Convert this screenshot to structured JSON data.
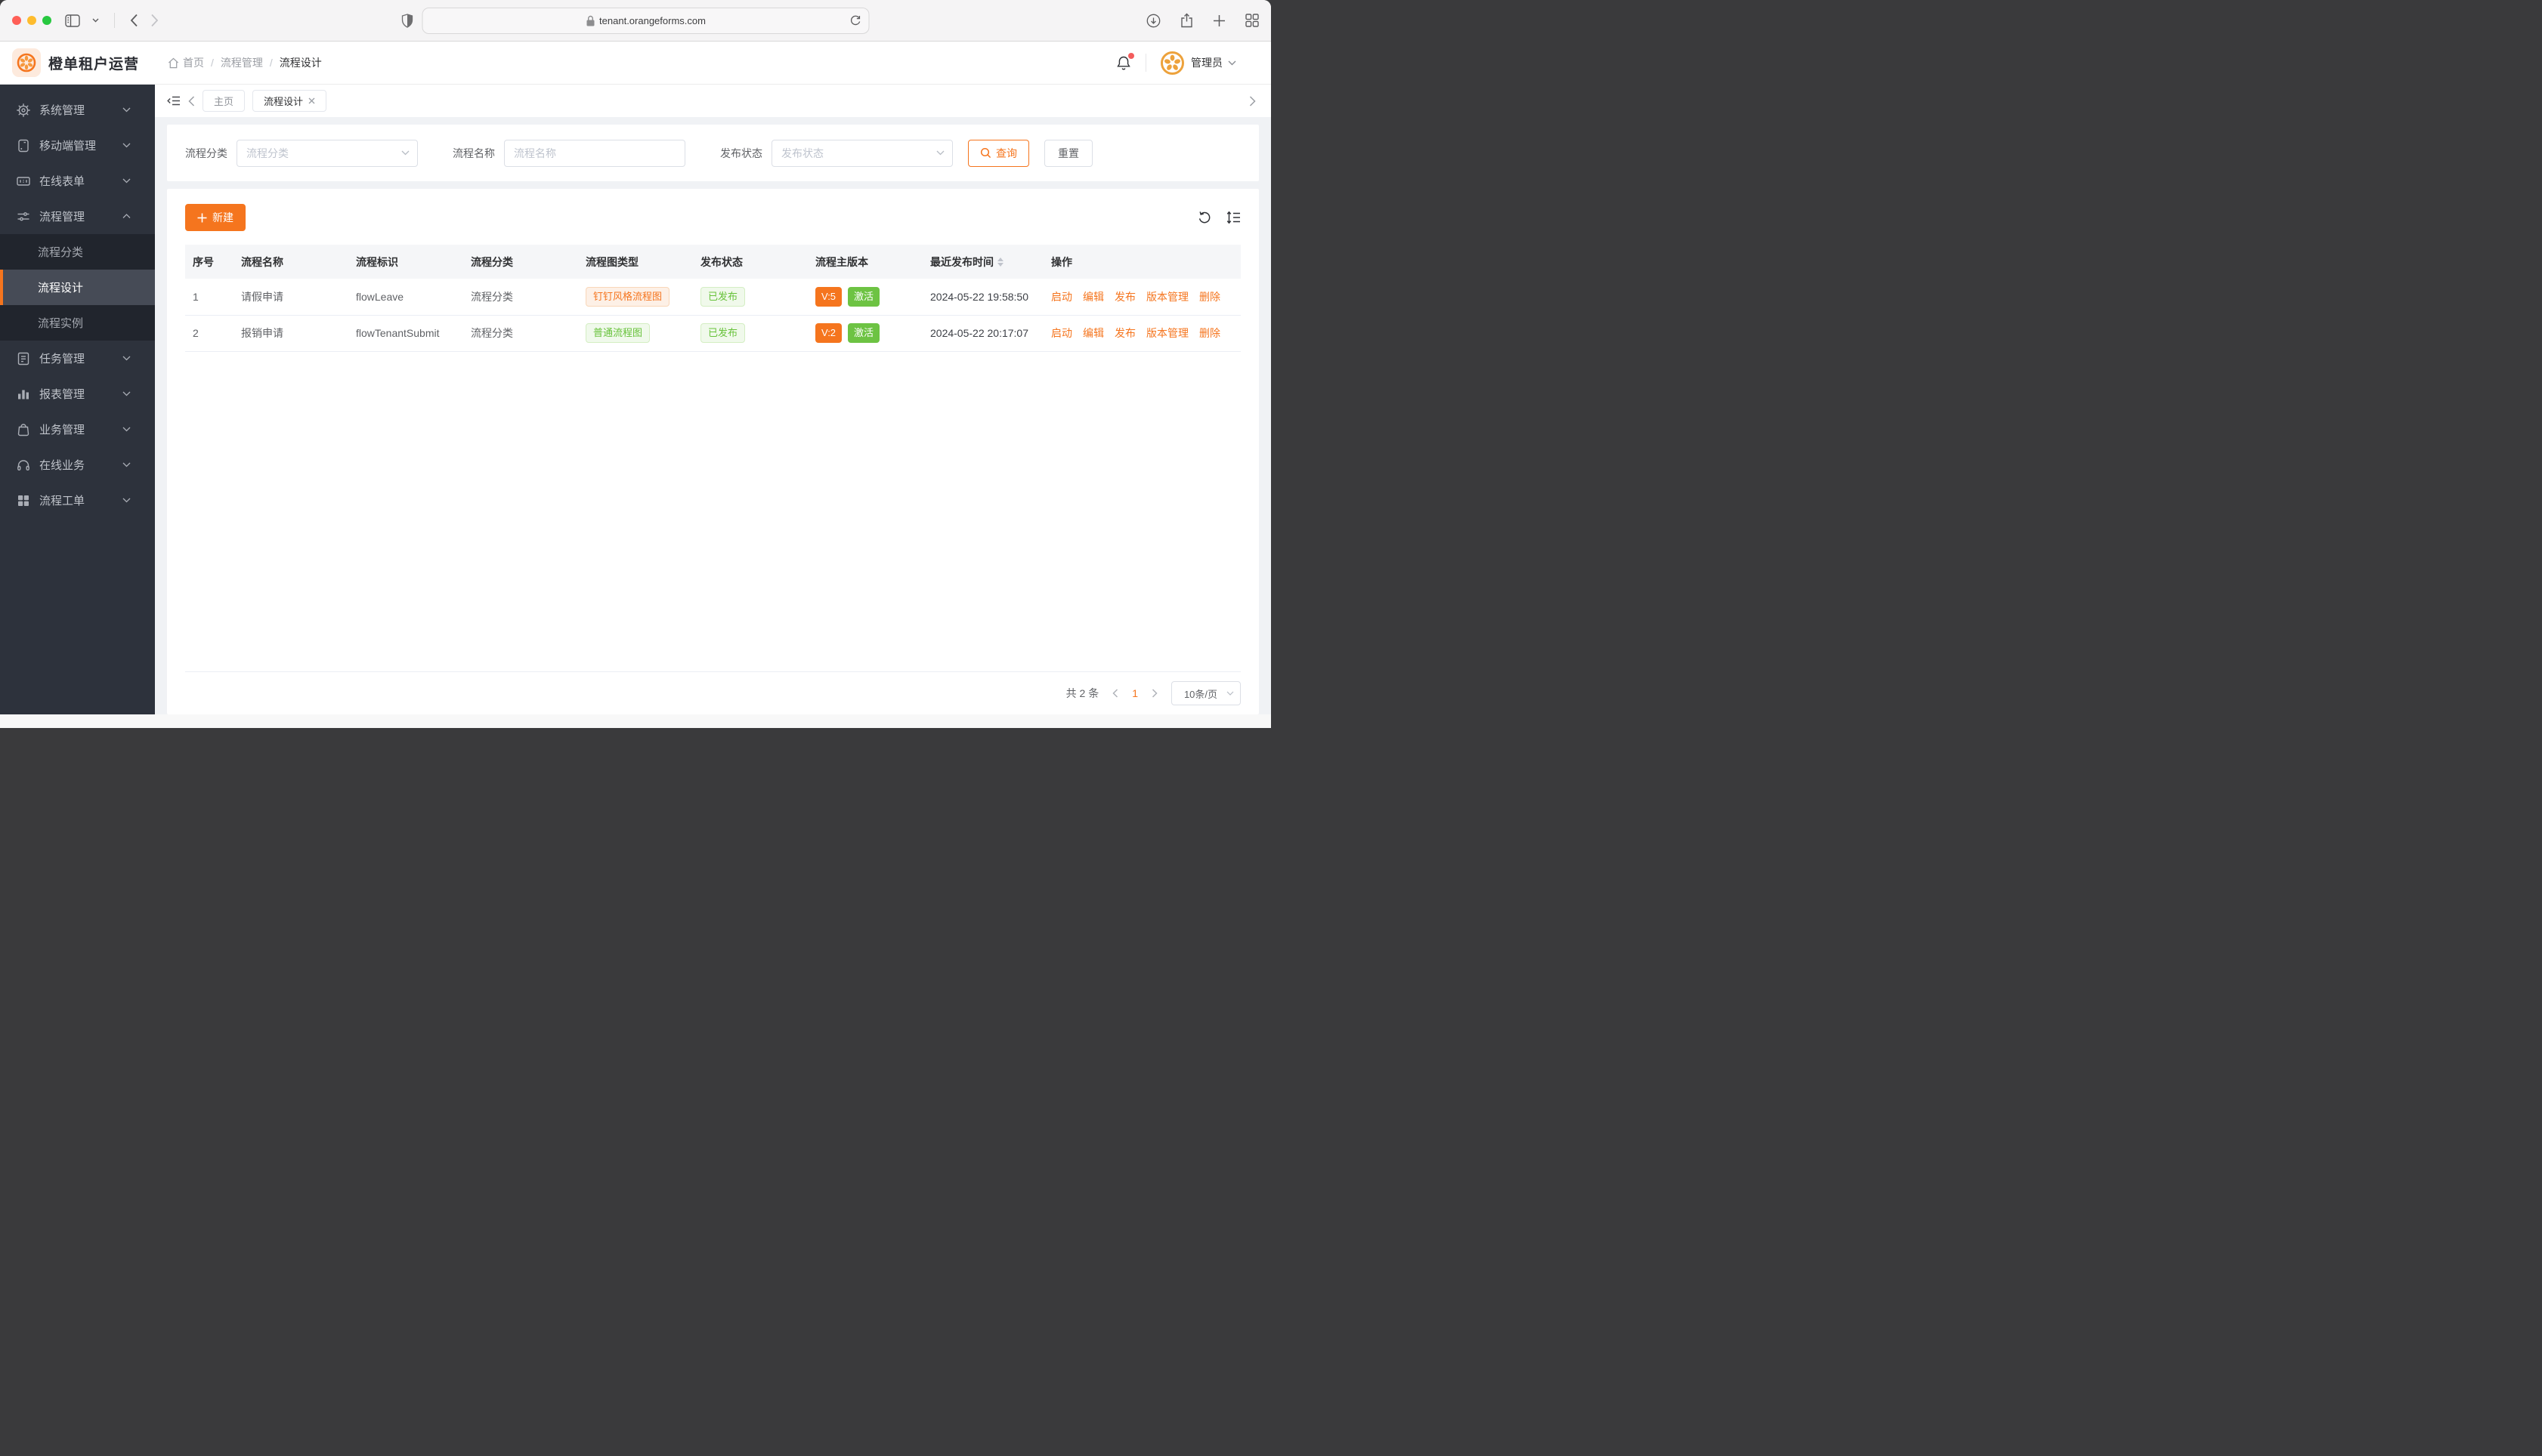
{
  "browser": {
    "url": "tenant.orangeforms.com"
  },
  "header": {
    "app_title": "橙单租户运营",
    "breadcrumb": {
      "home": "首页",
      "section": "流程管理",
      "current": "流程设计"
    },
    "user_name": "管理员"
  },
  "sidebar": {
    "items": [
      {
        "label": "系统管理"
      },
      {
        "label": "移动端管理"
      },
      {
        "label": "在线表单"
      },
      {
        "label": "流程管理",
        "children": [
          {
            "label": "流程分类"
          },
          {
            "label": "流程设计"
          },
          {
            "label": "流程实例"
          }
        ]
      },
      {
        "label": "任务管理"
      },
      {
        "label": "报表管理"
      },
      {
        "label": "业务管理"
      },
      {
        "label": "在线业务"
      },
      {
        "label": "流程工单"
      }
    ]
  },
  "tabs": {
    "home": "主页",
    "active": "流程设计"
  },
  "filters": {
    "category_label": "流程分类",
    "category_placeholder": "流程分类",
    "name_label": "流程名称",
    "name_placeholder": "流程名称",
    "status_label": "发布状态",
    "status_placeholder": "发布状态",
    "search_button": "查询",
    "reset_button": "重置"
  },
  "toolbar": {
    "create_button": "新建"
  },
  "table": {
    "columns": [
      "序号",
      "流程名称",
      "流程标识",
      "流程分类",
      "流程图类型",
      "发布状态",
      "流程主版本",
      "最近发布时间",
      "操作"
    ],
    "actions": [
      "启动",
      "编辑",
      "发布",
      "版本管理",
      "删除"
    ],
    "rows": [
      {
        "index": "1",
        "name": "请假申请",
        "key": "flowLeave",
        "category": "流程分类",
        "diagram_type": "钉钉风格流程图",
        "publish_status": "已发布",
        "version": "V:5",
        "state": "激活",
        "published_at": "2024-05-22 19:58:50"
      },
      {
        "index": "2",
        "name": "报销申请",
        "key": "flowTenantSubmit",
        "category": "流程分类",
        "diagram_type": "普通流程图",
        "publish_status": "已发布",
        "version": "V:2",
        "state": "激活",
        "published_at": "2024-05-22 20:17:07"
      }
    ]
  },
  "pagination": {
    "total": "共 2 条",
    "page": "1",
    "page_size": "10条/页"
  },
  "colors": {
    "accent": "#f5751e",
    "green": "#67c23a",
    "green_solid": "#6dc343",
    "sidebar_bg": "#2d323c"
  }
}
